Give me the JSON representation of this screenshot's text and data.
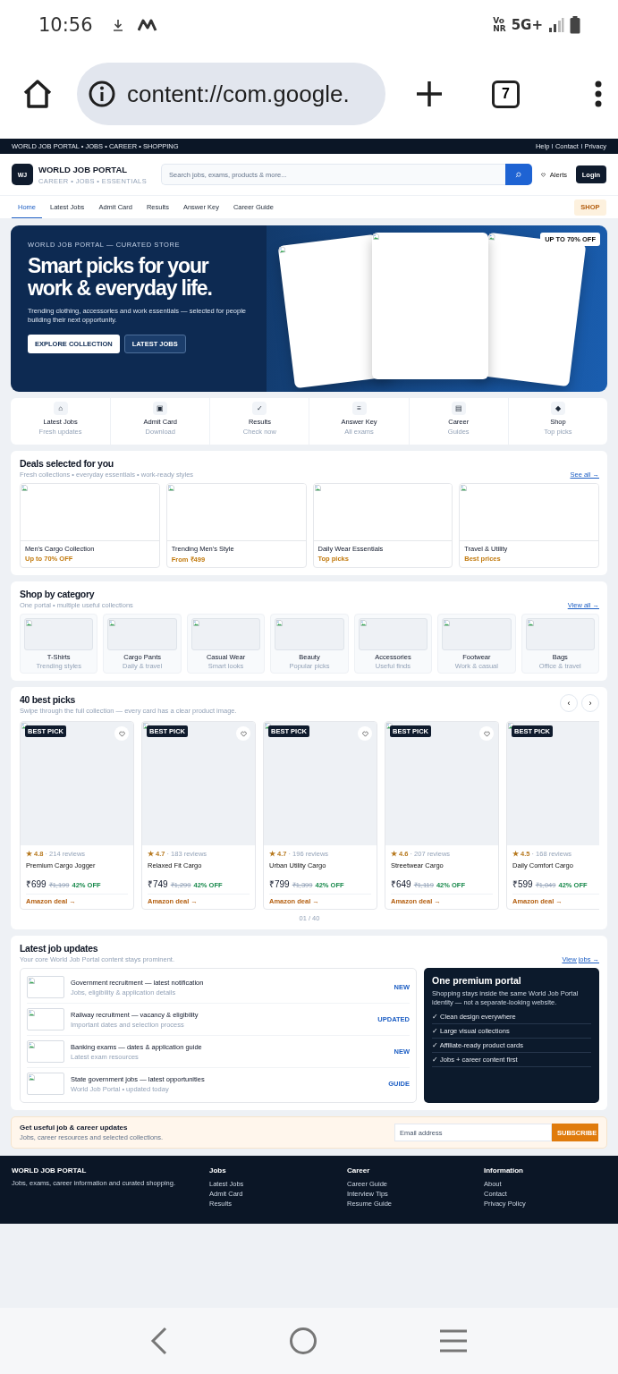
{
  "status_bar": {
    "time": "10:56",
    "vo": "Vo",
    "nr": "NR",
    "network": "5G+"
  },
  "browser": {
    "url": "content://com.google.",
    "tab_count": "7"
  },
  "topbar": {
    "tagline": "WORLD JOB PORTAL • JOBS • CAREER • SHOPPING",
    "links": [
      "Help",
      "Contact",
      "Privacy"
    ]
  },
  "header": {
    "logo_mark": "WJ",
    "brand": "WORLD JOB PORTAL",
    "brand_sub": "CAREER • JOBS • ESSENTIALS",
    "search_placeholder": "Search jobs, exams, products & more...",
    "alerts": "Alerts",
    "login": "Login"
  },
  "nav": {
    "tabs": [
      {
        "label": "Home",
        "selected": true
      },
      {
        "label": "Latest Jobs",
        "selected": false
      },
      {
        "label": "Admit Card",
        "selected": false
      },
      {
        "label": "Results",
        "selected": false
      },
      {
        "label": "Answer Key",
        "selected": false
      },
      {
        "label": "Career Guide",
        "selected": false
      }
    ],
    "shop": "SHOP"
  },
  "hero": {
    "eyebrow": "WORLD JOB PORTAL — CURATED STORE",
    "title": "Smart picks for your work & everyday life.",
    "text": "Trending clothing, accessories and work essentials — selected for people building their next opportunity.",
    "buttons": [
      {
        "label": "EXPLORE COLLECTION",
        "kind": "primary"
      },
      {
        "label": "LATEST JOBS",
        "kind": "secondary"
      }
    ],
    "badge": "UP TO 70% OFF"
  },
  "quick_links": [
    {
      "icon": "⌂",
      "label": "Latest Jobs",
      "sub": "Fresh updates"
    },
    {
      "icon": "▣",
      "label": "Admit Card",
      "sub": "Download"
    },
    {
      "icon": "✓",
      "label": "Results",
      "sub": "Check now"
    },
    {
      "icon": "≡",
      "label": "Answer Key",
      "sub": "All exams"
    },
    {
      "icon": "▤",
      "label": "Career",
      "sub": "Guides"
    },
    {
      "icon": "◆",
      "label": "Shop",
      "sub": "Top picks"
    }
  ],
  "deals": {
    "title": "Deals selected for you",
    "subtitle": "Fresh collections • everyday essentials • work-ready styles",
    "link": "See all →",
    "items": [
      {
        "name": "Men's Cargo Collection",
        "tag": "Up to 70% OFF"
      },
      {
        "name": "Trending Men's Style",
        "tag": "From ₹499"
      },
      {
        "name": "Daily Wear Essentials",
        "tag": "Top picks"
      },
      {
        "name": "Travel & Utility",
        "tag": "Best prices"
      }
    ]
  },
  "categories": {
    "title": "Shop by category",
    "subtitle": "One portal • multiple useful collections",
    "link": "View all →",
    "items": [
      {
        "name": "T-Shirts",
        "sub": "Trending styles"
      },
      {
        "name": "Cargo Pants",
        "sub": "Daily & travel"
      },
      {
        "name": "Casual Wear",
        "sub": "Smart looks"
      },
      {
        "name": "Beauty",
        "sub": "Popular picks"
      },
      {
        "name": "Accessories",
        "sub": "Useful finds"
      },
      {
        "name": "Footwear",
        "sub": "Work & casual"
      },
      {
        "name": "Bags",
        "sub": "Office & travel"
      }
    ]
  },
  "best_picks": {
    "title": "40 best picks",
    "subtitle": "Swipe through the full collection — every card has a clear product image.",
    "prev": "‹",
    "next": "›",
    "pager": "01 / 40",
    "items": [
      {
        "badge": "BEST PICK",
        "rating": "★ 4.8",
        "reviews": "· 214 reviews",
        "name": "Premium Cargo Jogger",
        "price": "₹699",
        "old_price": "₹1,199",
        "discount": "42% OFF",
        "link": "Amazon deal →"
      },
      {
        "badge": "BEST PICK",
        "rating": "★ 4.7",
        "reviews": "· 183 reviews",
        "name": "Relaxed Fit Cargo",
        "price": "₹749",
        "old_price": "₹1,299",
        "discount": "42% OFF",
        "link": "Amazon deal →"
      },
      {
        "badge": "BEST PICK",
        "rating": "★ 4.7",
        "reviews": "· 196 reviews",
        "name": "Urban Utility Cargo",
        "price": "₹799",
        "old_price": "₹1,399",
        "discount": "42% OFF",
        "link": "Amazon deal →"
      },
      {
        "badge": "BEST PICK",
        "rating": "★ 4.6",
        "reviews": "· 207 reviews",
        "name": "Streetwear Cargo",
        "price": "₹649",
        "old_price": "₹1,119",
        "discount": "42% OFF",
        "link": "Amazon deal →"
      },
      {
        "badge": "BEST PICK",
        "rating": "★ 4.5",
        "reviews": "· 168 reviews",
        "name": "Daily Comfort Cargo",
        "price": "₹599",
        "old_price": "₹1,049",
        "discount": "42% OFF",
        "link": "Amazon deal →"
      }
    ]
  },
  "jobs": {
    "title": "Latest job updates",
    "subtitle": "Your core World Job Portal content stays prominent.",
    "link": "View jobs →",
    "items": [
      {
        "title": "Government recruitment — latest notification",
        "sub": "Jobs, eligibility & application details",
        "tag": "NEW"
      },
      {
        "title": "Railway recruitment — vacancy & eligibility",
        "sub": "Important dates and selection process",
        "tag": "UPDATED"
      },
      {
        "title": "Banking exams — dates & application guide",
        "sub": "Latest exam resources",
        "tag": "NEW"
      },
      {
        "title": "State government jobs — latest opportunities",
        "sub": "World Job Portal • updated today",
        "tag": "GUIDE"
      }
    ],
    "promo": {
      "title": "One premium portal",
      "text": "Shopping stays inside the same World Job Portal identity — not a separate-looking website.",
      "features": [
        "✓ Clean design everywhere",
        "✓ Large visual collections",
        "✓ Affiliate-ready product cards",
        "✓ Jobs + career content first"
      ]
    }
  },
  "subscribe": {
    "title": "Get useful job & career updates",
    "subtitle": "Jobs, career resources and selected collections.",
    "placeholder": "Email address",
    "button": "SUBSCRIBE"
  },
  "footer": {
    "brand": "WORLD JOB PORTAL",
    "text": "Jobs, exams, career information and curated shopping.",
    "columns": [
      {
        "title": "Jobs",
        "links": [
          "Latest Jobs",
          "Admit Card",
          "Results"
        ]
      },
      {
        "title": "Career",
        "links": [
          "Career Guide",
          "Interview Tips",
          "Resume Guide"
        ]
      },
      {
        "title": "Information",
        "links": [
          "About",
          "Contact",
          "Privacy Policy"
        ]
      }
    ]
  }
}
